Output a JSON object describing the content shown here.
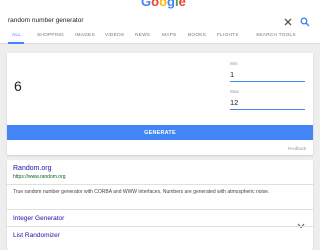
{
  "header": {
    "logo_letters": [
      {
        "char": "G",
        "color": "#4285f4"
      },
      {
        "char": "o",
        "color": "#ea4335"
      },
      {
        "char": "o",
        "color": "#fbbc05"
      },
      {
        "char": "g",
        "color": "#4285f4"
      },
      {
        "char": "l",
        "color": "#34a853"
      },
      {
        "char": "e",
        "color": "#ea4335"
      }
    ],
    "search_value": "random number generator",
    "clear_icon": "close-icon",
    "search_icon": "search-icon"
  },
  "tabs": [
    {
      "label": "ALL",
      "active": true
    },
    {
      "label": "SHOPPING",
      "active": false
    },
    {
      "label": "IMAGES",
      "active": false
    },
    {
      "label": "VIDEOS",
      "active": false
    },
    {
      "label": "NEWS",
      "active": false
    },
    {
      "label": "MAPS",
      "active": false
    },
    {
      "label": "BOOKS",
      "active": false
    },
    {
      "label": "FLIGHTS",
      "active": false
    },
    {
      "label": "SEARCH TOOLS",
      "active": false
    }
  ],
  "rng": {
    "result": "6",
    "min_label": "Min",
    "min_value": "1",
    "max_label": "Max",
    "max_value": "12",
    "generate_label": "GENERATE",
    "feedback_label": "Feedback"
  },
  "result_card": {
    "title": "Random.org",
    "url": "https://www.random.org",
    "snippet": "True random number generator with CORBA and WWW interfaces. Numbers are generated with atmospheric noise.",
    "sublinks": [
      {
        "label": "Integer Generator",
        "expandable": true
      },
      {
        "label": "List Randomizer",
        "expandable": false
      }
    ]
  },
  "colors": {
    "accent": "#4285f4",
    "link": "#1a0dab",
    "url": "#006621"
  }
}
